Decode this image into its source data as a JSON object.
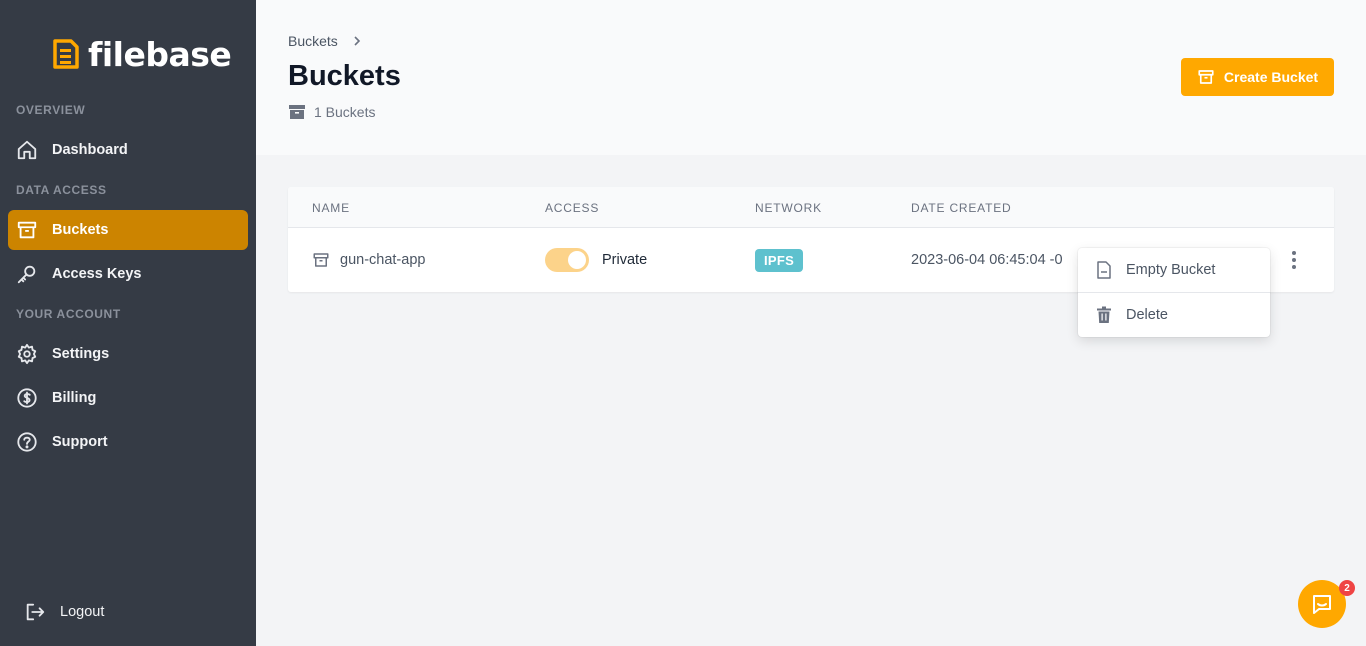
{
  "brand": {
    "name": "filebase",
    "accent": "#ffa800",
    "active_nav": "#cc8400",
    "sidebar_bg": "#353b45"
  },
  "sidebar": {
    "sections": {
      "overview": "OVERVIEW",
      "data_access": "DATA ACCESS",
      "your_account": "YOUR ACCOUNT"
    },
    "items": {
      "dashboard": {
        "label": "Dashboard",
        "icon": "home-icon"
      },
      "buckets": {
        "label": "Buckets",
        "icon": "archive-icon"
      },
      "access_keys": {
        "label": "Access Keys",
        "icon": "key-icon"
      },
      "settings": {
        "label": "Settings",
        "icon": "gear-icon"
      },
      "billing": {
        "label": "Billing",
        "icon": "dollar-icon"
      },
      "support": {
        "label": "Support",
        "icon": "question-icon"
      },
      "logout": {
        "label": "Logout",
        "icon": "logout-icon"
      }
    }
  },
  "header": {
    "breadcrumb": "Buckets",
    "title": "Buckets",
    "count": "1 Buckets",
    "create_button": "Create Bucket"
  },
  "table": {
    "columns": {
      "name": "NAME",
      "access": "ACCESS",
      "network": "NETWORK",
      "date_created": "DATE CREATED"
    },
    "rows": [
      {
        "name": "gun-chat-app",
        "access": "Private",
        "network": "IPFS",
        "date_created": "2023-06-04 06:45:04 -0"
      }
    ]
  },
  "dropdown": {
    "empty_bucket": "Empty Bucket",
    "delete": "Delete"
  },
  "chat": {
    "badge_count": "2"
  }
}
